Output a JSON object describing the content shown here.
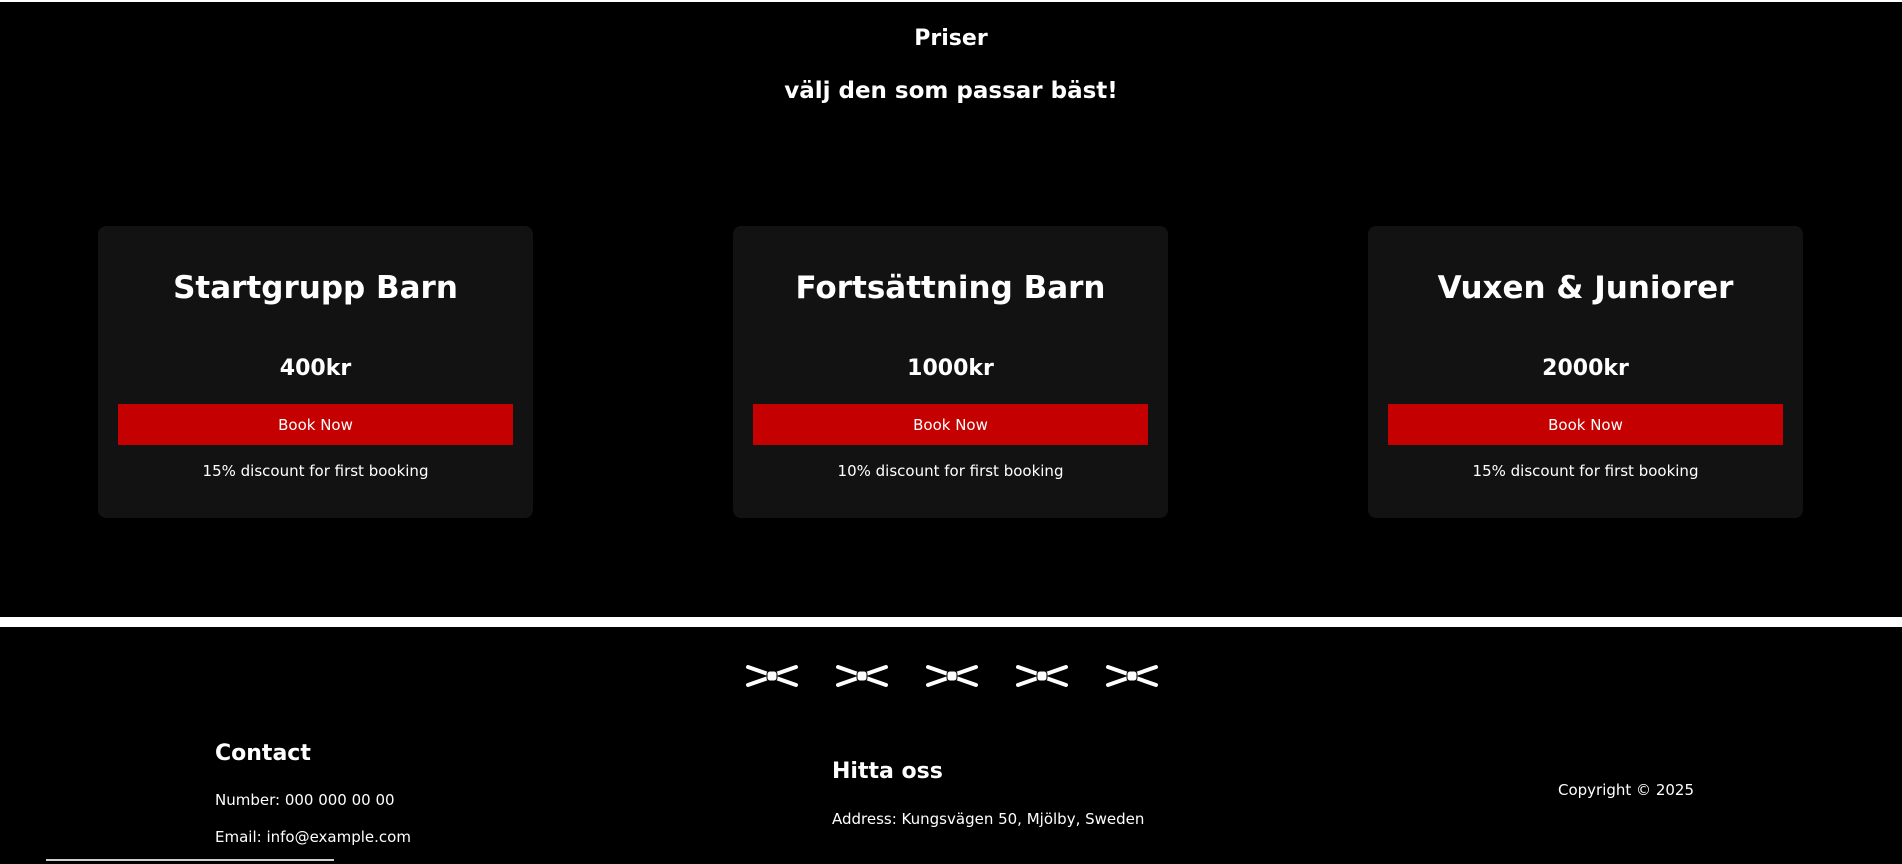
{
  "pricing": {
    "title": "Priser",
    "subtitle": "välj den som passar bäst!",
    "plans": [
      {
        "name": "Startgrupp Barn",
        "price": "400kr",
        "button_label": "Book Now",
        "note": "15% discount for first booking"
      },
      {
        "name": "Fortsättning Barn",
        "price": "1000kr",
        "button_label": "Book Now",
        "note": "10% discount for first booking"
      },
      {
        "name": "Vuxen & Juniorer",
        "price": "2000kr",
        "button_label": "Book Now",
        "note": "15% discount for first booking"
      }
    ]
  },
  "footer": {
    "belt_icons": [
      "belt-icon",
      "belt-icon",
      "belt-icon",
      "belt-icon",
      "belt-icon"
    ],
    "contact": {
      "heading": "Contact",
      "number": "Number: 000 000 00 00",
      "email": "Email: info@example.com"
    },
    "find_us": {
      "heading": "Hitta oss",
      "address": "Address: Kungsvägen 50, Mjölby, Sweden"
    },
    "copyright": "Copyright © 2025"
  },
  "colors": {
    "background": "#000000",
    "card": "#121212",
    "accent": "#c40000",
    "text": "#ffffff"
  }
}
